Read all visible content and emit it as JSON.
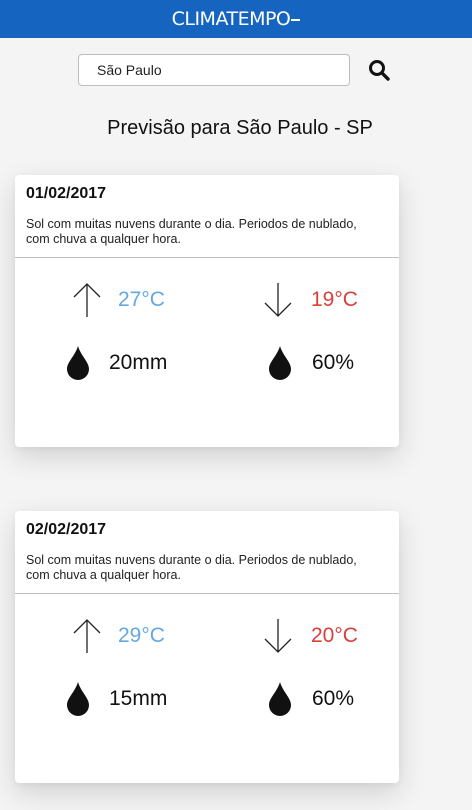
{
  "header": {
    "logo": "CLIMATEMPO"
  },
  "search": {
    "value": "São Paulo",
    "placeholder": ""
  },
  "page": {
    "title": "Previsão para São Paulo - SP"
  },
  "colors": {
    "brand": "#1565c0",
    "max_temp": "#64a8e0",
    "min_temp": "#d9403a"
  },
  "icons": {
    "search": "search-icon",
    "max": "arrow-up-icon",
    "min": "arrow-down-icon",
    "rain": "raindrop-icon",
    "humidity": "raindrop-icon"
  },
  "forecasts": [
    {
      "date": "01/02/2017",
      "description": "Sol com muitas nuvens durante o dia. Periodos de nublado, com chuva a qualquer hora.",
      "max_temp": "27°C",
      "min_temp": "19°C",
      "rain": "20mm",
      "humidity": "60%"
    },
    {
      "date": "02/02/2017",
      "description": "Sol com muitas nuvens durante o dia. Periodos de nublado, com chuva a qualquer hora.",
      "max_temp": "29°C",
      "min_temp": "20°C",
      "rain": "15mm",
      "humidity": "60%"
    }
  ]
}
